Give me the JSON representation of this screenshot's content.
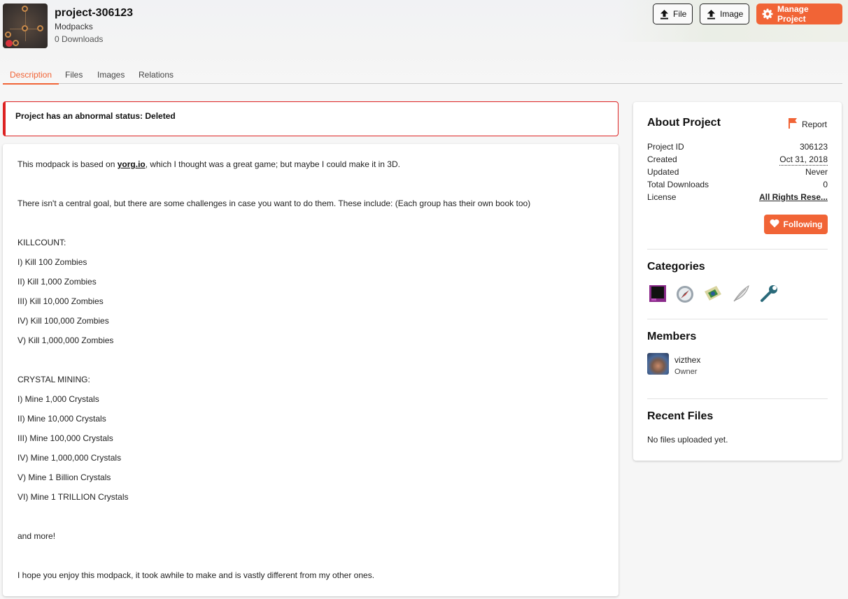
{
  "project": {
    "title": "project-306123",
    "type": "Modpacks",
    "downloads": "0 Downloads"
  },
  "header_buttons": {
    "file_label": "File",
    "image_label": "Image",
    "manage_label": "Manage Project",
    "accent_color": "#f16436"
  },
  "tabs": [
    {
      "label": "Description",
      "active": true
    },
    {
      "label": "Files",
      "active": false
    },
    {
      "label": "Images",
      "active": false
    },
    {
      "label": "Relations",
      "active": false
    }
  ],
  "status_alert": {
    "text": "Project has an abnormal status: Deleted",
    "color": "#dd2222"
  },
  "description": {
    "intro_before": "This modpack is based on ",
    "intro_link": "yorg.io",
    "intro_after": ", which I thought was a great game; but maybe I could make it in 3D.",
    "challenges_intro": "There isn't a central goal, but there are some challenges in case you want to do them. These include: (Each group has their own book too)",
    "killcount_heading": "KILLCOUNT:",
    "killcount_items": [
      "I) Kill 100 Zombies",
      "II) Kill 1,000 Zombies",
      "III) Kill 10,000 Zombies",
      "IV) Kill 100,000 Zombies",
      "V) Kill 1,000,000 Zombies"
    ],
    "crystal_heading": "CRYSTAL MINING:",
    "crystal_items": [
      "I) Mine 1,000 Crystals",
      "II) Mine 10,000 Crystals",
      "III) Mine 100,000 Crystals",
      "IV) Mine 1,000,000 Crystals",
      "V) Mine 1 Billion Crystals",
      "VI) Mine 1 TRILLION Crystals"
    ],
    "and_more": "and more!",
    "closing": "I hope you enjoy this modpack, it took awhile to make and is vastly different from my other ones."
  },
  "about": {
    "heading": "About Project",
    "report_label": "Report",
    "rows": [
      {
        "label": "Project ID",
        "value": "306123"
      },
      {
        "label": "Created",
        "value": "Oct 31, 2018"
      },
      {
        "label": "Updated",
        "value": "Never"
      },
      {
        "label": "Total Downloads",
        "value": "0"
      },
      {
        "label": "License",
        "value": "All Rights Rese..."
      }
    ],
    "follow_label": "Following"
  },
  "categories": {
    "heading": "Categories",
    "icons": [
      "magic-icon",
      "compass-icon",
      "map-icon",
      "feather-icon",
      "wrench-icon"
    ]
  },
  "members": {
    "heading": "Members",
    "list": [
      {
        "name": "vizthex",
        "role": "Owner"
      }
    ]
  },
  "recent_files": {
    "heading": "Recent Files",
    "empty_text": "No files uploaded yet."
  }
}
